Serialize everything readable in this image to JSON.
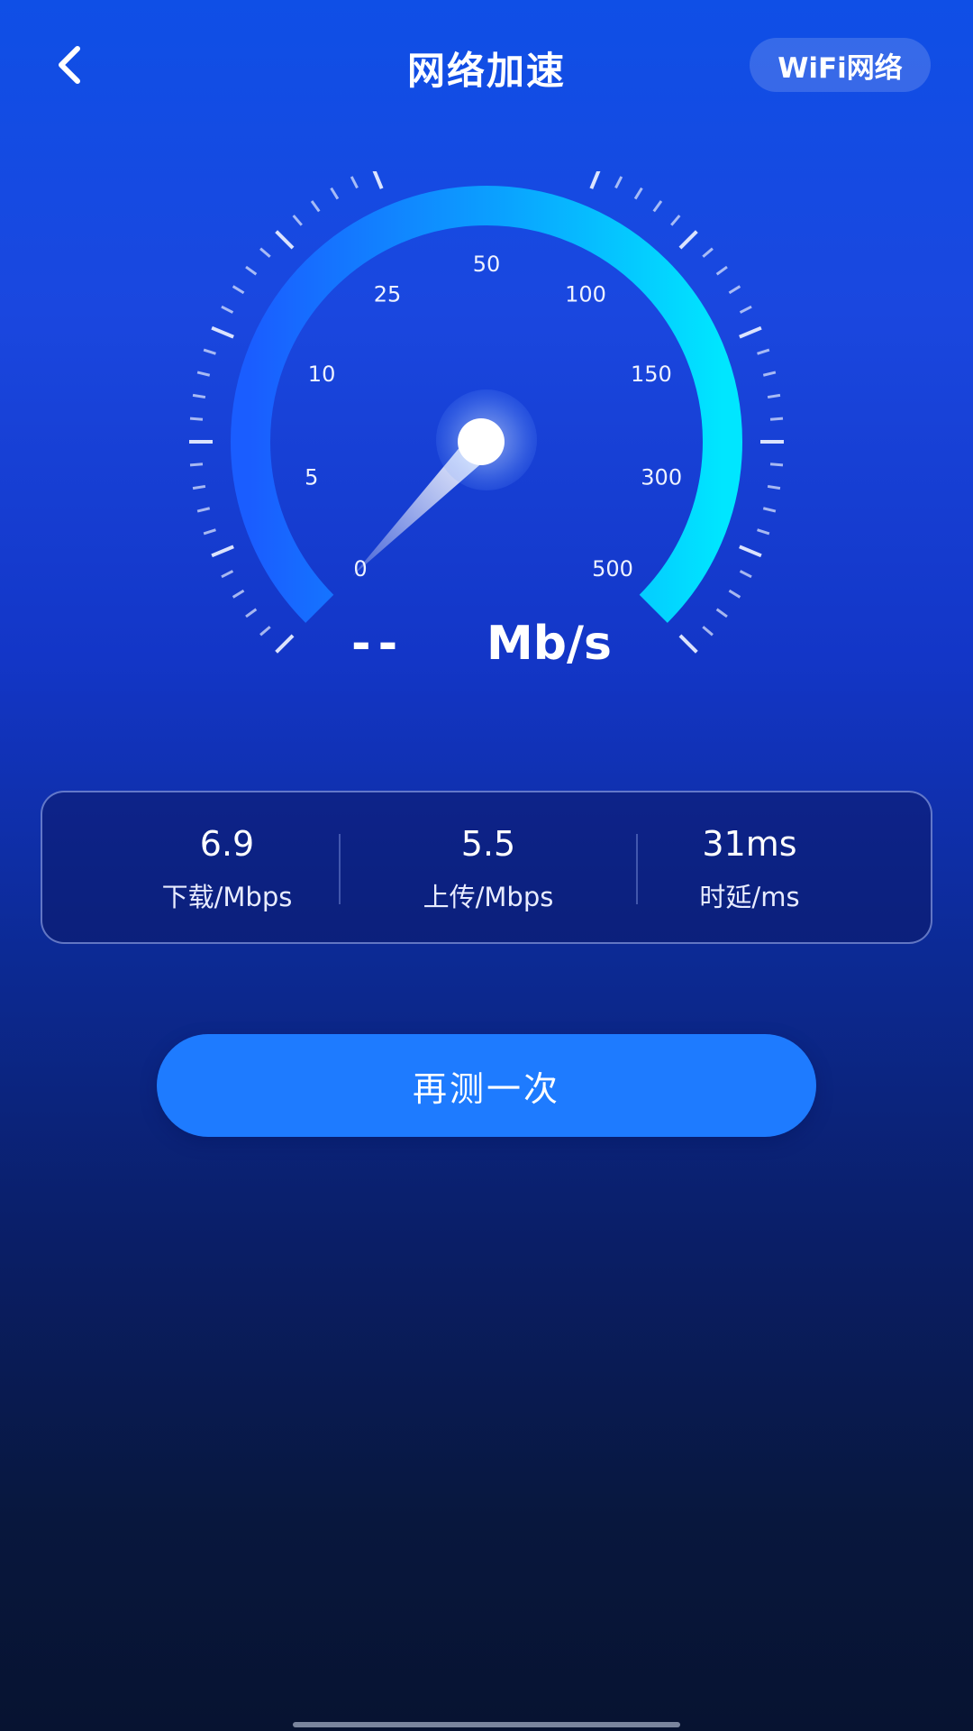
{
  "header": {
    "title": "网络加速",
    "network_button": "WiFi网络"
  },
  "gauge": {
    "scale_labels": [
      "0",
      "5",
      "10",
      "25",
      "50",
      "100",
      "150",
      "300",
      "500"
    ],
    "needle_reading": "0"
  },
  "speed": {
    "value": "--",
    "unit": "Mb/s"
  },
  "stats": [
    {
      "value": "6.9",
      "label": "下载/Mbps"
    },
    {
      "value": "5.5",
      "label": "上传/Mbps"
    },
    {
      "value": "31ms",
      "label": "时延/ms"
    }
  ],
  "actions": {
    "retest_label": "再测一次"
  },
  "colors": {
    "arc_start": "#1a5dff",
    "arc_end": "#00e6ff",
    "button": "#1e7bff"
  },
  "icons": {
    "back": "chevron-left-icon"
  }
}
